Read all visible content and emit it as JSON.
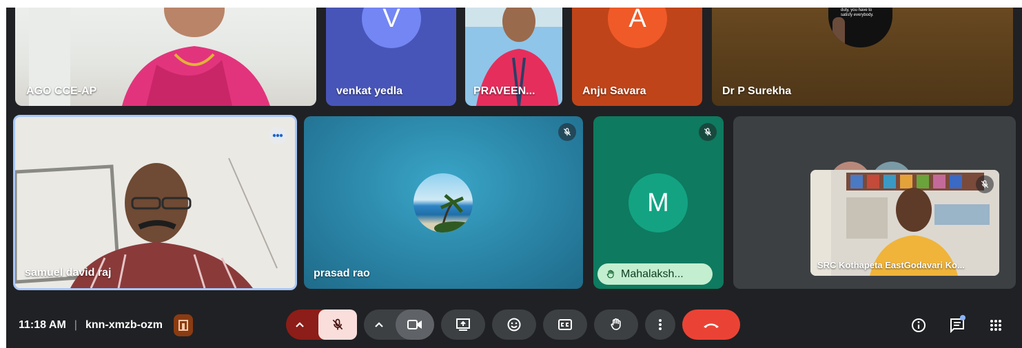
{
  "tiles": {
    "ago": {
      "name": "AGO CCE-AP"
    },
    "venkat": {
      "name": "venkat yedla",
      "initial": "V"
    },
    "praveen": {
      "name": "PRAVEEN..."
    },
    "anju": {
      "name": "Anju Savara",
      "initial": "A"
    },
    "surekha": {
      "name": "Dr P Surekha",
      "screen_text": "cil you perform your duty, you have to satisfy everybody."
    },
    "samuel": {
      "name": "samuel david raj"
    },
    "prasad": {
      "name": "prasad rao"
    },
    "mahalakshmi": {
      "name": "Mahalaksh...",
      "initial": "M"
    },
    "kothapeta": {
      "name": "SRC Kothapeta EastGodavari Ko..."
    }
  },
  "meeting": {
    "time": "11:18 AM",
    "separator": "|",
    "code": "knn-xmzb-ozm"
  },
  "icons": [
    "more-options-icon",
    "mic-off-icon",
    "chevron-up-icon",
    "camera-icon",
    "present-icon",
    "emoji-icon",
    "captions-icon",
    "raise-hand-icon",
    "more-vert-icon",
    "end-call-icon",
    "info-icon",
    "chat-icon",
    "apps-grid-icon",
    "host-controls-icon"
  ],
  "colors": {
    "stage_bg": "#202124",
    "control_gray": "#3c4043",
    "mic_off_red": "#8c1d18",
    "end_call": "#ea4335",
    "hand_raised_green": "#c4eed0"
  }
}
